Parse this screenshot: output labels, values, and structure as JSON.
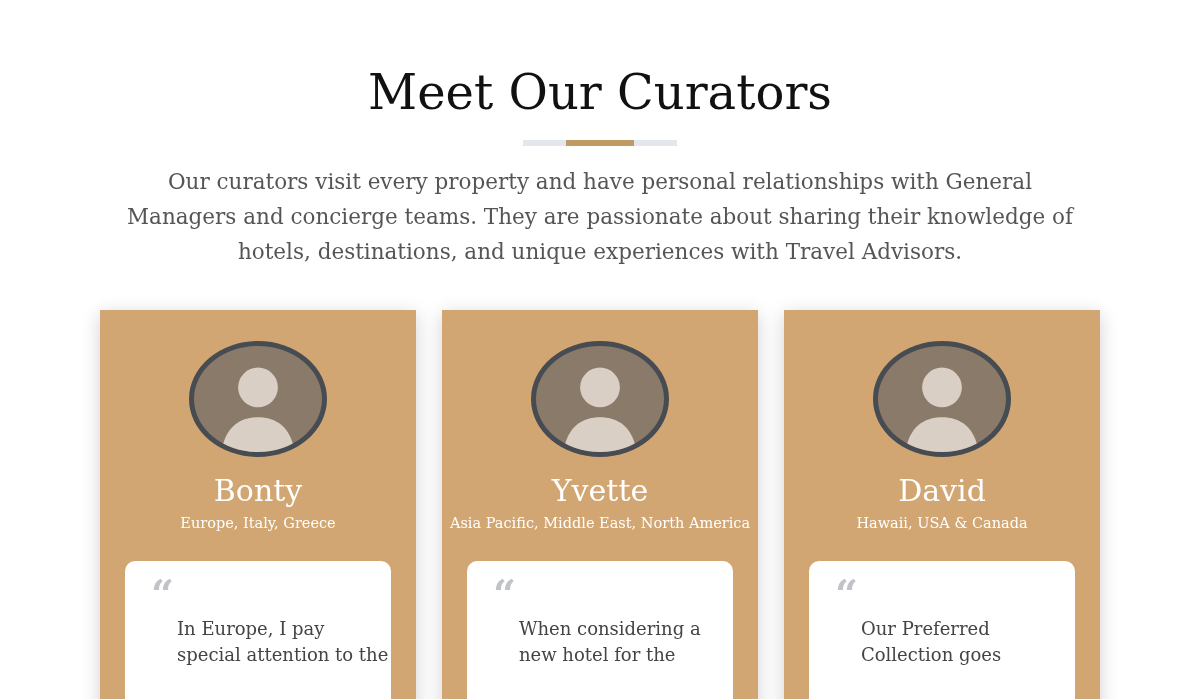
{
  "heading": "Meet Our Curators",
  "intro": "Our curators visit every property and have personal relationships with General Managers and concierge teams. They are passionate about sharing their knowledge of hotels, destinations, and unique experiences with Travel Advisors.",
  "curators": [
    {
      "name": "Bonty",
      "regions": "Europe, Italy, Greece",
      "quote_mark": "“",
      "quote_lines": [
        "In Europe, I pay",
        "special attention to the"
      ]
    },
    {
      "name": "Yvette",
      "regions": "Asia Pacific, Middle East, North America",
      "quote_mark": "“",
      "quote_lines": [
        "When considering a",
        "new hotel for the"
      ]
    },
    {
      "name": "David",
      "regions": "Hawaii, USA & Canada",
      "quote_mark": "“",
      "quote_lines": [
        "Our Preferred",
        "Collection goes"
      ]
    }
  ]
}
